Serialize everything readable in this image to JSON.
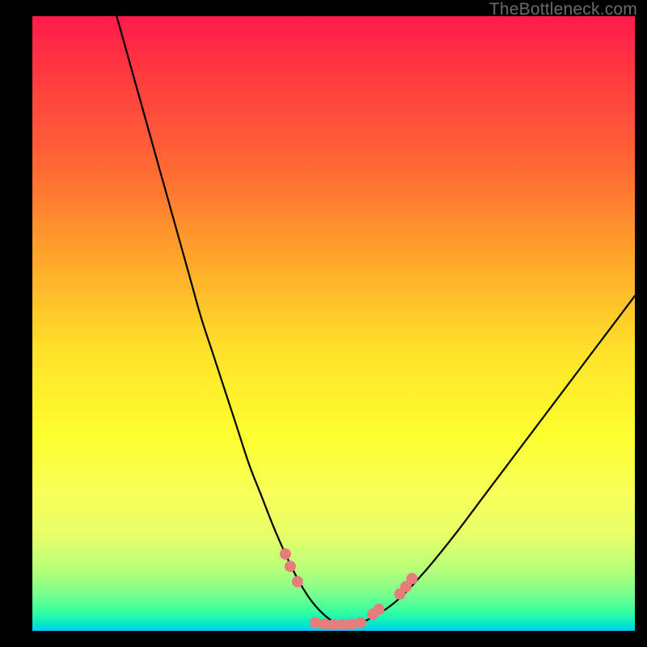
{
  "watermark": "TheBottleneck.com",
  "chart_data": {
    "type": "line",
    "title": "",
    "xlabel": "",
    "ylabel": "",
    "xlim": [
      0,
      100
    ],
    "ylim": [
      0,
      100
    ],
    "background_gradient": [
      "#ff1a4a",
      "#ffe32a",
      "#00e8cc"
    ],
    "series": [
      {
        "name": "curve",
        "x": [
          14,
          16,
          18,
          20,
          22,
          24,
          26,
          28,
          30,
          32,
          34,
          36,
          38,
          40,
          42,
          44,
          46,
          48,
          50,
          52,
          55,
          60,
          65,
          70,
          75,
          80,
          85,
          90,
          95,
          100
        ],
        "y": [
          100,
          93,
          86,
          79,
          72,
          65,
          58,
          51,
          45,
          39,
          33,
          27,
          22,
          17,
          12.5,
          8.5,
          5.3,
          3.0,
          1.5,
          1.1,
          1.5,
          4.5,
          9.5,
          15.5,
          22,
          28.5,
          35,
          41.5,
          48,
          54.5
        ]
      }
    ],
    "markers": [
      {
        "x": 42.0,
        "y": 12.5
      },
      {
        "x": 42.8,
        "y": 10.5
      },
      {
        "x": 44.0,
        "y": 8.0
      },
      {
        "x": 47.0,
        "y": 1.3
      },
      {
        "x": 48.5,
        "y": 1.1
      },
      {
        "x": 50.0,
        "y": 1.0
      },
      {
        "x": 51.5,
        "y": 1.0
      },
      {
        "x": 53.0,
        "y": 1.1
      },
      {
        "x": 54.5,
        "y": 1.3
      },
      {
        "x": 56.5,
        "y": 2.7
      },
      {
        "x": 57.5,
        "y": 3.5
      },
      {
        "x": 61.0,
        "y": 6.0
      },
      {
        "x": 62.0,
        "y": 7.2
      },
      {
        "x": 63.0,
        "y": 8.5
      }
    ]
  }
}
